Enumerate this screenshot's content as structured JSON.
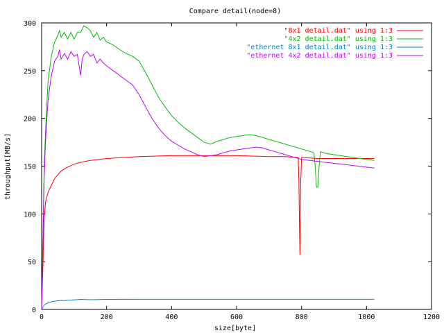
{
  "chart_data": {
    "type": "line",
    "title": "Compare detail(node=8)",
    "xlabel": "size[byte]",
    "ylabel": "throughput[MB/s]",
    "xlim": [
      0,
      1200
    ],
    "ylim": [
      0,
      300
    ],
    "x_ticks": [
      0,
      200,
      400,
      600,
      800,
      1000,
      1200
    ],
    "y_ticks": [
      0,
      50,
      100,
      150,
      200,
      250,
      300
    ],
    "grid": false,
    "legend_position": "top-right",
    "series": [
      {
        "name": "\"8x1 detail.dat\" using 1:3",
        "color": "#ff0000",
        "x": [
          0,
          4,
          8,
          12,
          16,
          20,
          30,
          40,
          50,
          60,
          80,
          100,
          120,
          150,
          200,
          250,
          300,
          350,
          400,
          450,
          500,
          550,
          600,
          650,
          700,
          750,
          790,
          792,
          795,
          797,
          800,
          803,
          806,
          850,
          900,
          950,
          1000,
          1024
        ],
        "y": [
          0,
          45,
          95,
          112,
          118,
          123,
          130,
          137,
          141,
          145,
          149,
          152,
          154,
          156,
          158,
          159,
          160,
          160.5,
          161,
          161,
          161,
          161,
          161,
          160.5,
          160,
          160,
          159,
          130,
          57,
          130,
          159,
          159,
          159,
          158,
          158,
          158,
          158,
          158
        ]
      },
      {
        "name": "\"4x2 detail.dat\" using 1:3",
        "color": "#00bb00",
        "x": [
          0,
          4,
          8,
          12,
          16,
          20,
          30,
          40,
          50,
          55,
          60,
          70,
          80,
          90,
          100,
          110,
          120,
          130,
          140,
          150,
          160,
          170,
          180,
          190,
          200,
          220,
          240,
          260,
          280,
          300,
          320,
          340,
          360,
          380,
          400,
          420,
          440,
          460,
          480,
          500,
          520,
          540,
          560,
          580,
          600,
          620,
          640,
          660,
          680,
          700,
          720,
          740,
          760,
          780,
          800,
          820,
          838,
          842,
          846,
          850,
          854,
          858,
          880,
          920,
          960,
          1000,
          1024
        ],
        "y": [
          0,
          80,
          150,
          185,
          215,
          240,
          265,
          280,
          287,
          292,
          285,
          290,
          283,
          290,
          283,
          290,
          290,
          297,
          295,
          292,
          285,
          290,
          282,
          285,
          280,
          277,
          272,
          268,
          265,
          260,
          248,
          235,
          222,
          212,
          203,
          196,
          190,
          185,
          180,
          175,
          173,
          176,
          178,
          180,
          181,
          182,
          183,
          182,
          180,
          178,
          176,
          174,
          172,
          170,
          168,
          166,
          164,
          150,
          128,
          128,
          150,
          165,
          163,
          161,
          159,
          157,
          156
        ]
      },
      {
        "name": "\"ethernet 8x1 detail.dat\" using 1:3",
        "color": "#0080c0",
        "x": [
          0,
          5,
          10,
          15,
          20,
          30,
          40,
          50,
          60,
          70,
          80,
          100,
          120,
          150,
          200,
          300,
          400,
          500,
          600,
          700,
          800,
          900,
          1000,
          1024
        ],
        "y": [
          0,
          3,
          5,
          6,
          7,
          8,
          8.5,
          9,
          9.5,
          9.2,
          9.6,
          10,
          10.5,
          10.2,
          10.5,
          10.6,
          10.6,
          10.6,
          10.6,
          10.6,
          10.6,
          10.6,
          10.6,
          10.6
        ]
      },
      {
        "name": "\"ethernet 4x2 detail.dat\" using 1:3",
        "color": "#c000ff",
        "x": [
          0,
          4,
          8,
          12,
          16,
          20,
          30,
          40,
          50,
          55,
          60,
          70,
          80,
          90,
          100,
          110,
          120,
          125,
          130,
          140,
          150,
          160,
          170,
          180,
          190,
          200,
          220,
          240,
          260,
          280,
          300,
          320,
          340,
          360,
          380,
          400,
          420,
          440,
          460,
          480,
          500,
          520,
          540,
          560,
          580,
          600,
          620,
          640,
          660,
          680,
          700,
          720,
          740,
          760,
          780,
          800,
          850,
          900,
          950,
          1000,
          1024
        ],
        "y": [
          0,
          70,
          140,
          175,
          200,
          220,
          245,
          260,
          265,
          272,
          262,
          268,
          262,
          270,
          265,
          267,
          245,
          262,
          267,
          270,
          265,
          267,
          258,
          262,
          258,
          255,
          250,
          245,
          240,
          235,
          225,
          212,
          200,
          190,
          182,
          176,
          172,
          168,
          165,
          162,
          160,
          161,
          162,
          164,
          166,
          167,
          168,
          169,
          170,
          169,
          167,
          165,
          163,
          161,
          159,
          157,
          155,
          153,
          151,
          149,
          148
        ]
      }
    ]
  }
}
